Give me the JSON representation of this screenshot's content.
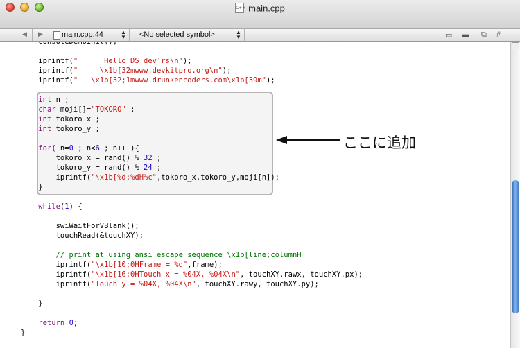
{
  "window": {
    "title": "main.cpp",
    "file_icon_label": "C++"
  },
  "navbar": {
    "back_icon": "back-arrow-icon",
    "forward_icon": "forward-arrow-icon",
    "file_location": "main.cpp:44",
    "symbol": "<No selected symbol>",
    "right_icons": [
      "bookmarks-icon",
      "breakpoints-icon",
      "counterpart-icon",
      "includes-icon"
    ],
    "includes_label": "#"
  },
  "code_lines": [
    "    consoleDemoInit();",
    "",
    "    iprintf(\"      Hello DS dev'rs\\n\");",
    "    iprintf(\"     \\x1b[32mwww.devkitpro.org\\n\");",
    "    iprintf(\"   \\x1b[32;1mwww.drunkencoders.com\\x1b[39m\");",
    "",
    "    int n ;",
    "    char moji[]=\"TOKORO\" ;",
    "    int tokoro_x ;",
    "    int tokoro_y ;",
    "",
    "    for( n=0 ; n<6 ; n++ ){",
    "        tokoro_x = rand() % 32 ;",
    "        tokoro_y = rand() % 24 ;",
    "        iprintf(\"\\x1b[%d;%dH%c\",tokoro_x,tokoro_y,moji[n]);",
    "    }",
    "",
    "    while(1) {",
    "",
    "        swiWaitForVBlank();",
    "        touchRead(&touchXY);",
    "",
    "        // print at using ansi escape sequence \\x1b[line;columnH",
    "        iprintf(\"\\x1b[10;0HFrame = %d\",frame);",
    "        iprintf(\"\\x1b[16;0HTouch x = %04X, %04X\\n\", touchXY.rawx, touchXY.px);",
    "        iprintf(\"Touch y = %04X, %04X\\n\", touchXY.rawy, touchXY.py);",
    "",
    "    }",
    "",
    "    return 0;",
    "}"
  ],
  "annotation": {
    "text": "ここに追加"
  },
  "colors": {
    "keyword": "#881280",
    "string": "#c41a16",
    "number": "#1c00cf",
    "comment": "#007400",
    "scroll_thumb": "#4a82cf"
  }
}
